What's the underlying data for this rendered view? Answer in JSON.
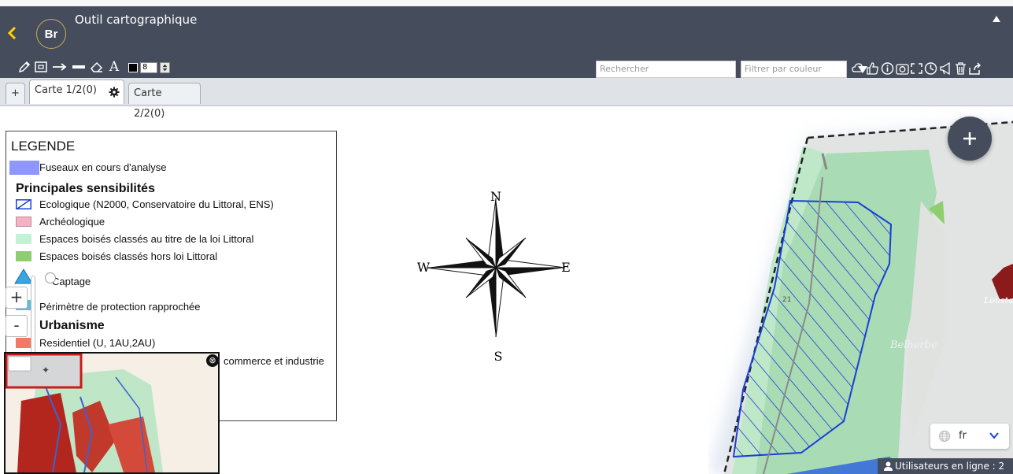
{
  "header": {
    "logo_text": "Br",
    "title": "Outil cartographique"
  },
  "toolbar": {
    "text_tool_label": "A",
    "stroke_size": "8",
    "search_placeholder": "Rechercher",
    "filter_label": "Filtrer par couleur"
  },
  "tabs": [
    {
      "label": "+"
    },
    {
      "label": "Carte 1/2(0)"
    },
    {
      "label": "Carte 2/2(0)"
    }
  ],
  "legend": {
    "title": "LEGENDE",
    "items": [
      {
        "label": "Fuseaux en cours d'analyse",
        "color": "#8d97ff"
      },
      {
        "label": "Principales sensibilités"
      },
      {
        "label": "Ecologique (N2000, Conservatoire du Littoral, ENS)",
        "color": "#1a3fd6"
      },
      {
        "label": "Archéologique",
        "color": "#f2b3c4"
      },
      {
        "label": "Espaces boisés classés au titre de la loi Littoral",
        "color": "#bff2d6"
      },
      {
        "label": "Espaces boisés classés hors loi Littoral",
        "color": "#8fce6f"
      },
      {
        "label": "Captage",
        "color": "#3aa6e0"
      },
      {
        "label": "Périmètre de protection rapprochée",
        "color": "#5cc0d8"
      },
      {
        "label": "Urbanisme"
      },
      {
        "label": "Residentiel (U, 1AU,2AU)",
        "color": "#f07a62"
      },
      {
        "label": "commerce et industrie"
      }
    ]
  },
  "compass": {
    "n": "N",
    "e": "E",
    "s": "S",
    "w": "W"
  },
  "zoom": {
    "in": "+",
    "out": "-"
  },
  "map": {
    "place_belherbe": "Belherbe",
    "place_loustalet": "Loustalet",
    "road_21": "21"
  },
  "language": "fr",
  "status": {
    "online_users": "Utilisateurs en ligne : 2"
  },
  "colors": {
    "header_bg": "#454c5b",
    "accent": "#ffd400",
    "ecologique_hatch": "#1a3fd6"
  }
}
